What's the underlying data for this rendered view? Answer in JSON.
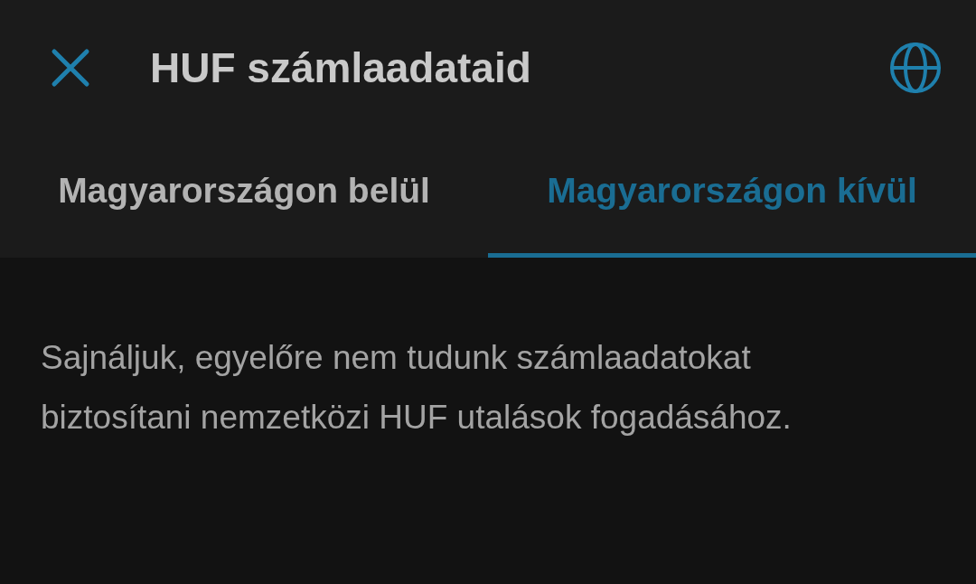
{
  "header": {
    "title": "HUF számlaadataid"
  },
  "tabs": [
    {
      "label": "Magyarországon belül",
      "selected": false
    },
    {
      "label": "Magyarországon kívül",
      "selected": true
    }
  ],
  "message": "Sajnáljuk, egyelőre nem tudunk számlaadatokat biztosítani nemzetközi HUF utalások fogadásához."
}
